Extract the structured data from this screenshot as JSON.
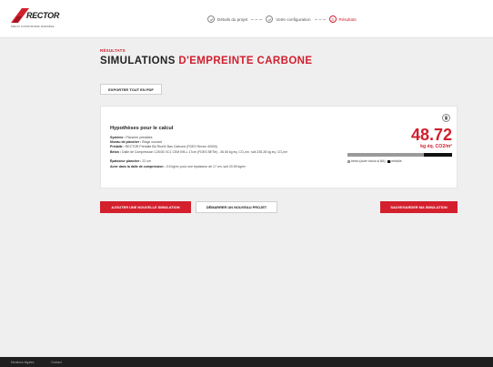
{
  "brand": {
    "name": "RECTOR",
    "tagline": "MIEUX CONSTRUIRE DURABLE",
    "accent_color": "#d0202e"
  },
  "steps": [
    {
      "label": "Détails du projet",
      "state": "done",
      "icon": "check-icon"
    },
    {
      "label": "Votre configuration",
      "state": "done",
      "icon": "check-icon"
    },
    {
      "label": "Résultats",
      "state": "active",
      "number": "3"
    }
  ],
  "page": {
    "eyebrow": "RÉSULTATS",
    "title_main": "SIMULATIONS",
    "title_accent": "D'EMPREINTE CARBONE"
  },
  "toolbar": {
    "export_label": "EXPORTER TOUT EN PDF"
  },
  "simulation": {
    "title": "Hypothèses pour le calcul",
    "hypotheses": [
      {
        "label": "Système :",
        "value": "Plancher prédalles"
      },
      {
        "label": "Niveau de plancher :",
        "value": "Étage courant"
      },
      {
        "label": "Prédalle :",
        "value": "RECTOR Prédalle BA RicelX Bas Carbone (FDES Rector 40000)"
      },
      {
        "label": "Béton :",
        "value": "Dalle de Compression C25/30 XC1 CEM II/B-L 17cm (FDES BETie) - 36.06 kg éq. CO₂/m², soit 235.28 kg éq. CO₂/m³"
      },
      {
        "label": "Épaisseur plancher :",
        "value": "22 cm"
      },
      {
        "label": "Acier dans la dalle de compression :",
        "value": "3.5 kg/m² pour une épaisseur de 17 cm, soit 20.59 kg/m³"
      }
    ],
    "result_value": "48.72",
    "result_unit": "kg éq. CO2/m²",
    "breakdown": {
      "beton_fraction": 0.73,
      "beton_label": "béton (acier inclus si BA)",
      "predalle_label": "prédalle",
      "beton_color": "#9a9a9a",
      "predalle_color": "#111111"
    }
  },
  "actions": {
    "add_label": "AJOUTER UNE NOUVELLE SIMULATION",
    "new_project_label": "DÉMARRER UN NOUVEAU PROJET",
    "save_label": "SAUVEGARDER MA SIMULATION"
  },
  "footer": {
    "links": [
      "Mentions légales",
      "Contact"
    ]
  }
}
